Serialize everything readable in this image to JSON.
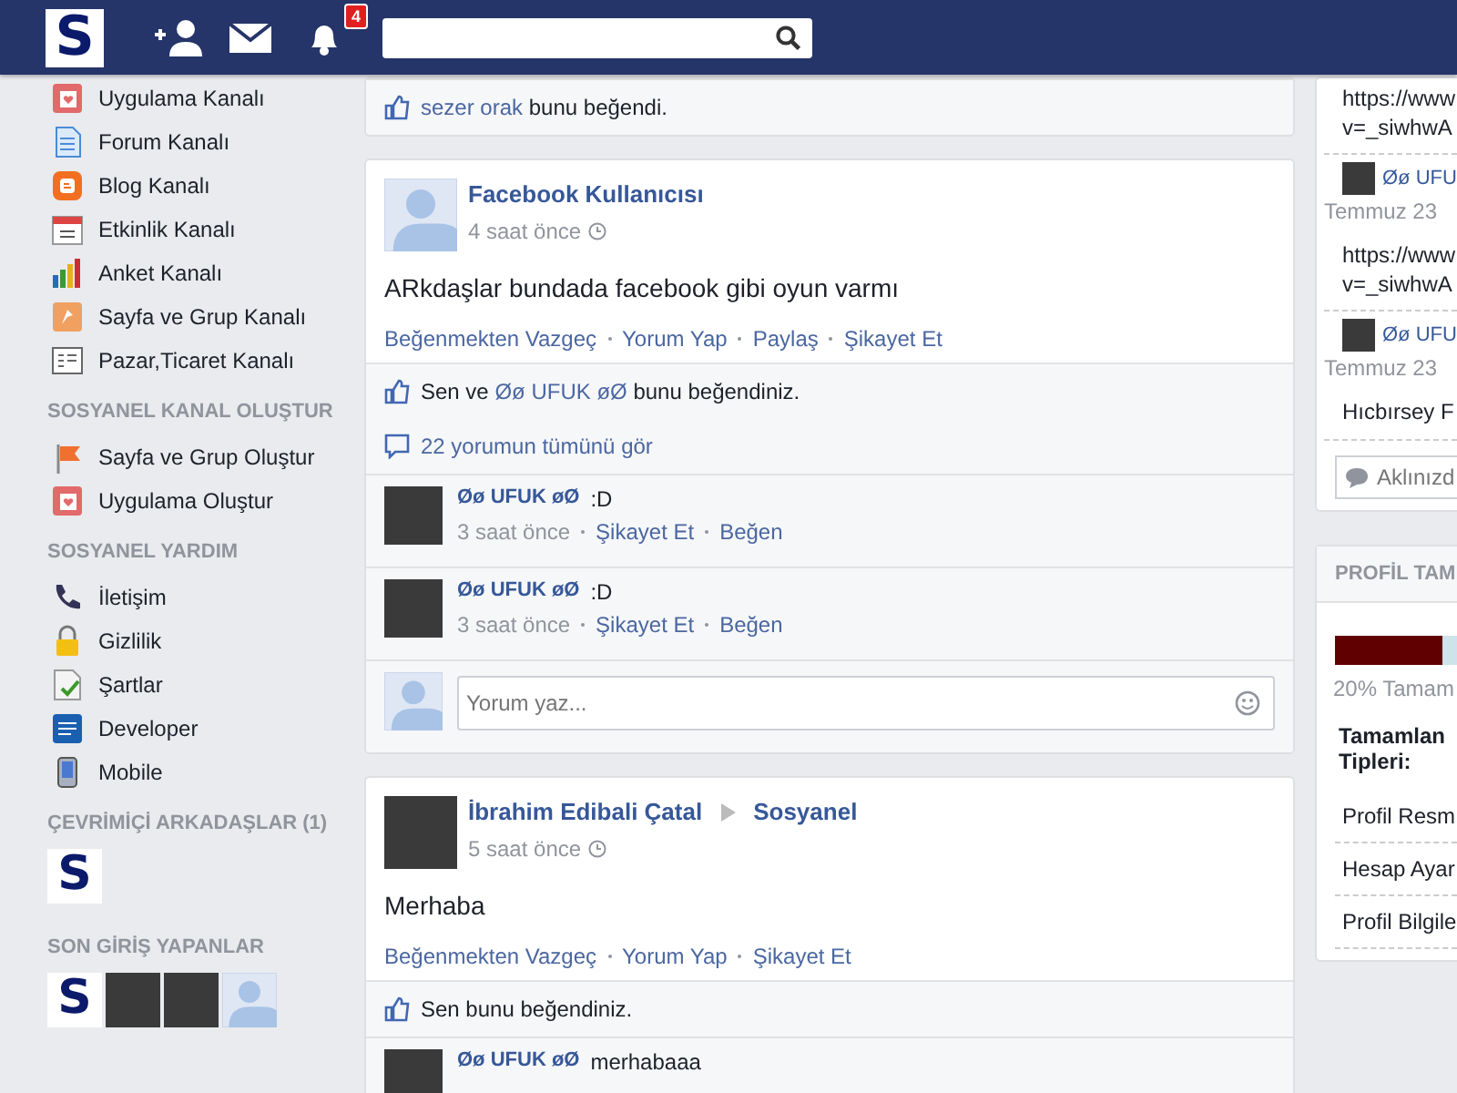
{
  "header": {
    "logo": "S",
    "notification_count": "4"
  },
  "sidebar": {
    "sections": [
      {
        "items": [
          {
            "label": "Uygulama Kanalı",
            "kind": "app"
          },
          {
            "label": "Forum Kanalı",
            "kind": "forum"
          },
          {
            "label": "Blog Kanalı",
            "kind": "blog"
          },
          {
            "label": "Etkinlik Kanalı",
            "kind": "calendar"
          },
          {
            "label": "Anket Kanalı",
            "kind": "poll"
          },
          {
            "label": "Sayfa ve Grup Kanalı",
            "kind": "page"
          },
          {
            "label": "Pazar,Ticaret Kanalı",
            "kind": "market"
          }
        ]
      },
      {
        "title": "SOSYANEL KANAL OLUŞTUR",
        "items": [
          {
            "label": "Sayfa ve Grup Oluştur",
            "kind": "flag"
          },
          {
            "label": "Uygulama Oluştur",
            "kind": "app"
          }
        ]
      },
      {
        "title": "SOSYANEL YARDIM",
        "items": [
          {
            "label": "İletişim",
            "kind": "phone"
          },
          {
            "label": "Gizlilik",
            "kind": "lock"
          },
          {
            "label": "Şartlar",
            "kind": "terms"
          },
          {
            "label": "Developer",
            "kind": "dev"
          },
          {
            "label": "Mobile",
            "kind": "mobile"
          }
        ]
      },
      {
        "title": "ÇEVRİMİÇİ ARKADAŞLAR (1)",
        "avatars": [
          {
            "kind": "logo",
            "text": "S"
          }
        ]
      },
      {
        "title": "SON GİRİŞ YAPANLAR",
        "avatars": [
          {
            "kind": "logo",
            "text": "S"
          },
          {
            "kind": "photo"
          },
          {
            "kind": "photo"
          },
          {
            "kind": "silhouette"
          }
        ]
      }
    ]
  },
  "feed": [
    {
      "likes": [
        {
          "text": "sezer orak",
          "link": true
        },
        {
          "text": " bunu beğendi.",
          "link": false
        }
      ]
    },
    {
      "author": "Facebook Kullanıcısı",
      "avatar": {
        "kind": "silhouette"
      },
      "time": "4 saat önce",
      "body": "ARkdaşlar bundada facebook gibi oyun varmı",
      "actions": [
        "Beğenmekten Vazgeç",
        "Yorum Yap",
        "Paylaş",
        "Şikayet Et"
      ],
      "likes": [
        {
          "text": "Sen ve ",
          "link": false
        },
        {
          "text": "Øø UFUK øØ",
          "link": true
        },
        {
          "text": " bunu beğendiniz.",
          "link": false
        }
      ],
      "view_all": "22 yorumun tümünü gör",
      "comments": [
        {
          "author": "Øø UFUK øØ",
          "text": ":D",
          "time": "3 saat önce",
          "actions": [
            "Şikayet Et",
            "Beğen"
          ]
        },
        {
          "author": "Øø UFUK øØ",
          "text": ":D",
          "time": "3 saat önce",
          "actions": [
            "Şikayet Et",
            "Beğen"
          ]
        }
      ],
      "comment_box": {
        "placeholder": "Yorum yaz..."
      }
    },
    {
      "author": "İbrahim Edibali Çatal",
      "target": "Sosyanel",
      "avatar": {
        "kind": "photo"
      },
      "time": "5 saat önce",
      "body": "Merhaba",
      "actions": [
        "Beğenmekten Vazgeç",
        "Yorum Yap",
        "Şikayet Et"
      ],
      "likes": [
        {
          "text": "Sen bunu beğendiniz.",
          "link": false
        }
      ],
      "comments": [
        {
          "author": "Øø UFUK øØ",
          "text": "merhabaaa"
        }
      ]
    }
  ],
  "right": {
    "messages": [
      {
        "link": "https://www\nv=_siwhwA"
      },
      {
        "author": "Øø UFU",
        "date": "Temmuz 23",
        "link": "https://www\nv=_siwhwA"
      },
      {
        "author": "Øø UFU",
        "date": "Temmuz 23",
        "text": "Hıcbırsey F"
      }
    ],
    "chat_input": {
      "placeholder": "Aklınızd"
    },
    "profile": {
      "title": "PROFİL TAM",
      "level": 0.87,
      "percent": "20% Tamam",
      "subtitle": "Tamamlan\nTipleri:",
      "items": [
        "Profil Resm",
        "Hesap Ayar",
        "Profil Bilgile"
      ]
    }
  }
}
